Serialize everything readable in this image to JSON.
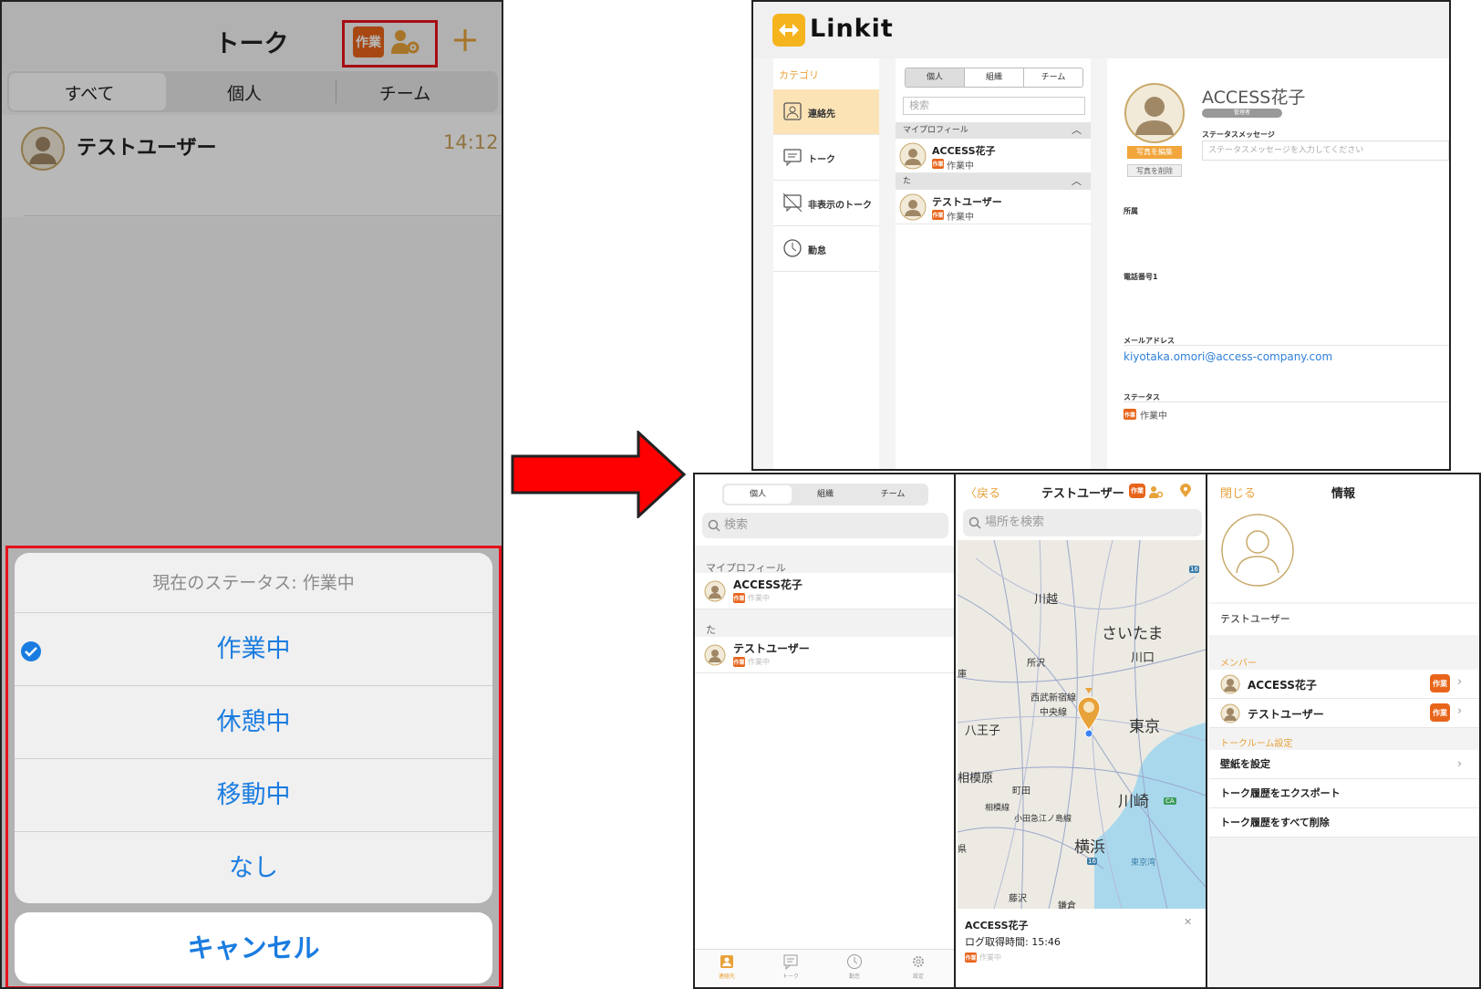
{
  "phone": {
    "title": "トーク",
    "status_badge": "作業",
    "tabs": [
      "すべて",
      "個人",
      "チーム"
    ],
    "chat_row": {
      "name": "テストユーザー",
      "time": "14:12"
    },
    "action_sheet": {
      "header": "現在のステータス: 作業中",
      "options": [
        "作業中",
        "休憩中",
        "移動中",
        "なし"
      ],
      "selected": "作業中",
      "cancel": "キャンセル"
    }
  },
  "desktop": {
    "app_name": "Linkit",
    "categories_header": "カテゴリ",
    "categories": [
      {
        "label": "連絡先",
        "icon": "contacts-icon",
        "selected": true
      },
      {
        "label": "トーク",
        "icon": "chat-icon",
        "selected": false
      },
      {
        "label": "非表示のトーク",
        "icon": "hidden-chat-icon",
        "selected": false
      },
      {
        "label": "勤怠",
        "icon": "clock-icon",
        "selected": false
      }
    ],
    "tabs": [
      "個人",
      "組織",
      "チーム"
    ],
    "search_placeholder": "検索",
    "sections": [
      {
        "title": "マイプロフィール",
        "items": [
          {
            "name": "ACCESS花子",
            "badge": "作業",
            "status": "作業中"
          }
        ]
      },
      {
        "title": "た",
        "items": [
          {
            "name": "テストユーザー",
            "badge": "作業",
            "status": "作業中"
          }
        ]
      }
    ],
    "profile": {
      "name": "ACCESS花子",
      "role": "管理者",
      "edit_photo": "写真を編集",
      "delete_photo": "写真を削除",
      "status_message_label": "ステータスメッセージ",
      "status_message_placeholder": "ステータスメッセージを入力してください",
      "affiliation_label": "所属",
      "phone_label": "電話番号1",
      "email_label": "メールアドレス",
      "email": "kiyotaka.omori@access-company.com",
      "status_label": "ステータス",
      "status_badge": "作業",
      "status_value": "作業中"
    }
  },
  "mobile_contacts": {
    "tabs": [
      "個人",
      "組織",
      "チーム"
    ],
    "search_placeholder": "検索",
    "sections": [
      {
        "title": "マイプロフィール",
        "name": "ACCESS花子",
        "badge": "作業",
        "status": "作業中"
      },
      {
        "title": "た",
        "name": "テストユーザー",
        "badge": "作業",
        "status": "作業中"
      }
    ],
    "tabbar": [
      {
        "label": "連絡先",
        "icon": "contacts-icon"
      },
      {
        "label": "トーク",
        "icon": "chat-icon"
      },
      {
        "label": "勤怠",
        "icon": "clock-icon"
      },
      {
        "label": "設定",
        "icon": "gear-icon"
      }
    ]
  },
  "mobile_map": {
    "back": "戻る",
    "title": "テストユーザー",
    "badge": "作業",
    "search_placeholder": "場所を検索",
    "places": [
      "川越",
      "さいたま",
      "川口",
      "所沢",
      "西武新宿線",
      "中央線",
      "八王子",
      "東京",
      "相模原",
      "町田",
      "川崎",
      "横浜",
      "藤沢",
      "鎌倉",
      "相模線",
      "小田急江ノ島線",
      "東京湾",
      "県",
      "庫",
      "16",
      "16",
      "CA"
    ],
    "popup": {
      "name": "ACCESS花子",
      "log_time": "ログ取得時間: 15:46",
      "badge": "作業",
      "status": "作業中"
    }
  },
  "mobile_info": {
    "close": "閉じる",
    "title": "情報",
    "room_name": "テストユーザー",
    "members_header": "メンバー",
    "members": [
      {
        "name": "ACCESS花子",
        "badge": "作業"
      },
      {
        "name": "テストユーザー",
        "badge": "作業"
      }
    ],
    "settings_header": "トークルーム設定",
    "settings": [
      "壁紙を設定",
      "トーク履歴をエクスポート",
      "トーク履歴をすべて削除"
    ]
  },
  "colors": {
    "accent_orange": "#e8a23a",
    "badge_orange": "#e8641b",
    "ios_blue": "#1a7ce0",
    "highlight_red": "#e5121b"
  }
}
